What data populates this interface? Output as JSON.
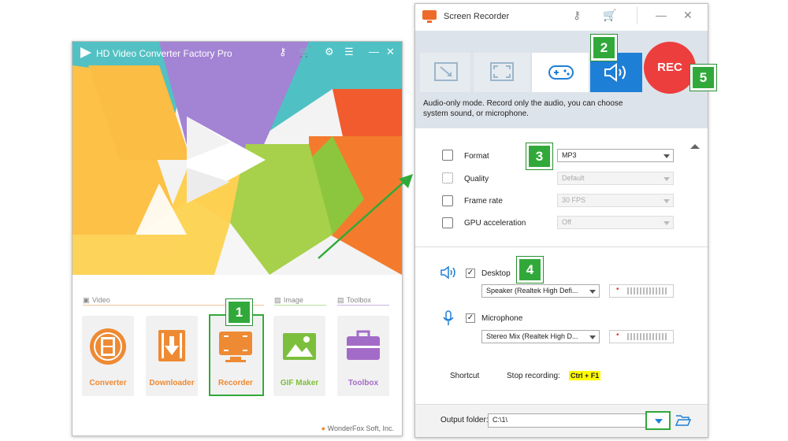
{
  "left_window": {
    "title": "HD Video Converter Factory Pro",
    "categories": [
      {
        "label": "Video",
        "icon": "video-icon"
      },
      {
        "label": "Image",
        "icon": "image-icon"
      },
      {
        "label": "Toolbox",
        "icon": "toolbox-icon"
      }
    ],
    "tools": [
      {
        "label": "Converter",
        "icon": "film-reel-icon",
        "color": "#ee8a33"
      },
      {
        "label": "Downloader",
        "icon": "download-icon",
        "color": "#ee8a33"
      },
      {
        "label": "Recorder",
        "icon": "screen-record-icon",
        "color": "#ee8a33"
      },
      {
        "label": "GIF Maker",
        "icon": "picture-icon",
        "color": "#7cbf3c"
      },
      {
        "label": "Toolbox",
        "icon": "toolbox-icon",
        "color": "#a36bc8"
      }
    ],
    "footer": "WonderFox Soft, Inc."
  },
  "right_window": {
    "title": "Screen Recorder",
    "rec_label": "REC",
    "mode_description": "Audio-only mode. Record only the audio, you can choose system sound, or microphone.",
    "settings": [
      {
        "label": "Format",
        "value": "MP3",
        "enabled": true
      },
      {
        "label": "Quality",
        "value": "Default",
        "enabled": false
      },
      {
        "label": "Frame rate",
        "value": "30 FPS",
        "enabled": false
      },
      {
        "label": "GPU acceleration",
        "value": "Off",
        "enabled": false
      }
    ],
    "desktop": {
      "label": "Desktop",
      "device": "Speaker (Realtek High Defi...",
      "checked": true
    },
    "microphone": {
      "label": "Microphone",
      "device": "Stereo Mix (Realtek High D...",
      "checked": true
    },
    "shortcut_label": "Shortcut",
    "stop_label": "Stop recording:",
    "stop_key": "Ctrl + F1",
    "output_label": "Output folder:",
    "output_value": "C:\\1\\"
  },
  "badges": [
    "1",
    "2",
    "3",
    "4",
    "5"
  ],
  "colors": {
    "accent_blue": "#1e7fd6",
    "rec_red": "#ed3e3e",
    "badge_green": "#31a93a",
    "highlight_yellow": "#fffc00"
  }
}
